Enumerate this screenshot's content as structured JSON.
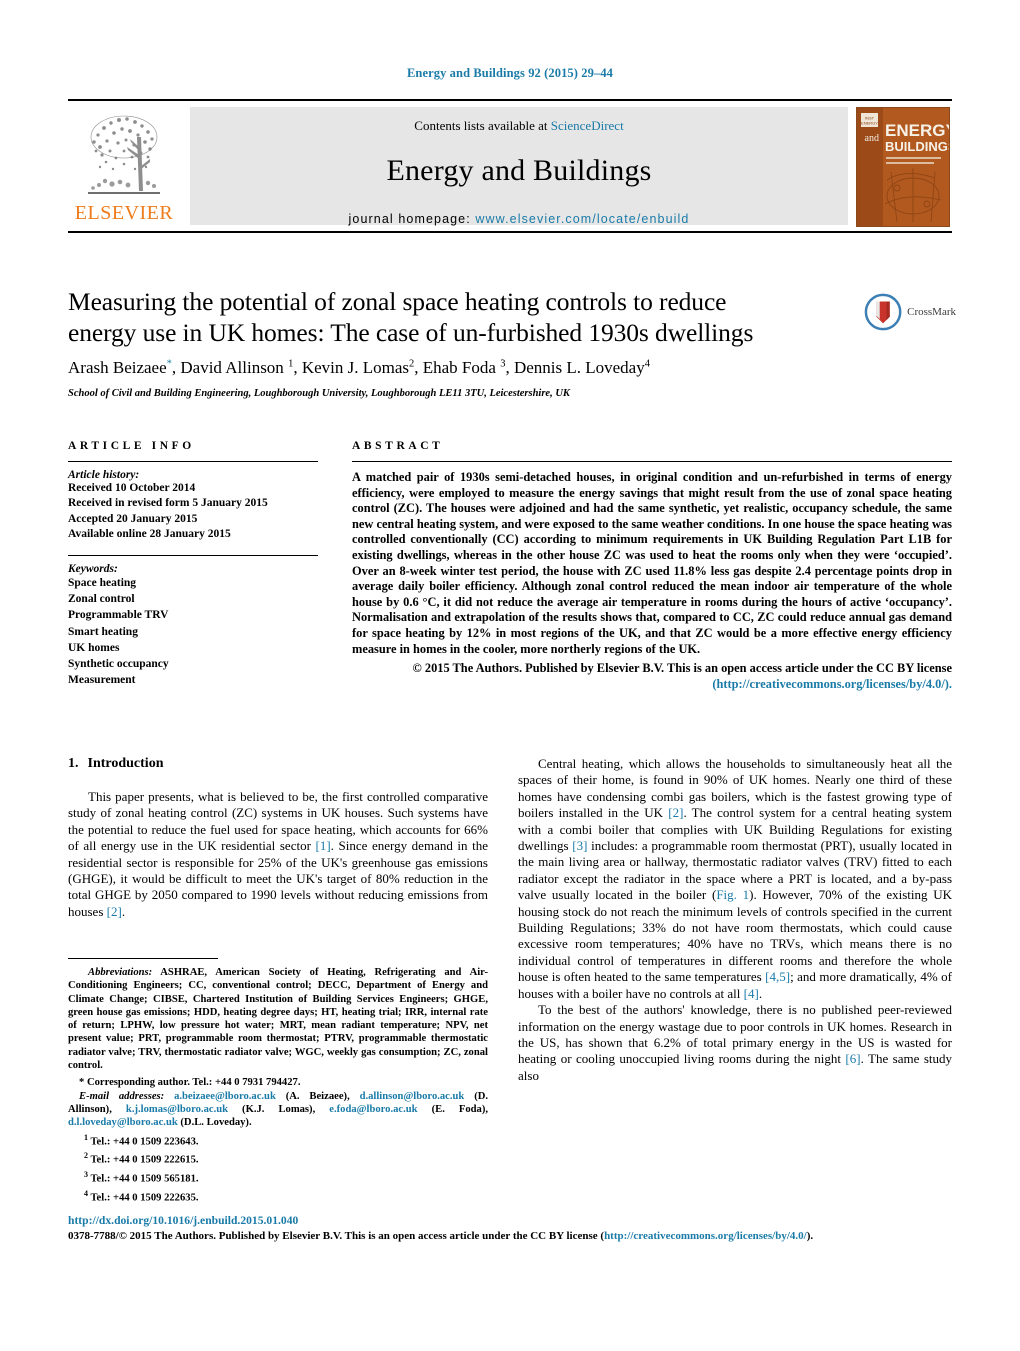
{
  "running_head": "Energy and Buildings 92 (2015) 29–44",
  "masthead": {
    "publisher_name": "ELSEVIER",
    "tree_logo_name": "elsevier-tree-logo",
    "contents_prefix": "Contents lists available at ",
    "sciencedirect_label": "ScienceDirect",
    "journal_title": "Energy and Buildings",
    "homepage_label": "journal homepage:",
    "homepage_url": "www.elsevier.com/locate/enbuild",
    "cover": {
      "and_word": "and",
      "line1": "ENERGY",
      "line2": "BUILDINGS"
    }
  },
  "article": {
    "title": "Measuring the potential of zonal space heating controls to reduce energy use in UK homes: The case of un-furbished 1930s dwellings",
    "crossmark_label": "CrossMark",
    "authors_html": "Arash Beizaee<sup class=\"star\">*</sup>, David Allinson <sup>1</sup>, Kevin J. Lomas<sup>2</sup>, Ehab Foda <sup>3</sup>, Dennis L. Loveday<sup>4</sup>",
    "affiliation": "School of Civil and Building Engineering, Loughborough University, Loughborough LE11 3TU, Leicestershire, UK"
  },
  "article_info": {
    "heading": "ARTICLE INFO",
    "history_label": "Article history:",
    "history": [
      "Received 10 October 2014",
      "Received in revised form 5 January 2015",
      "Accepted 20 January 2015",
      "Available online 28 January 2015"
    ],
    "keywords_label": "Keywords:",
    "keywords": [
      "Space heating",
      "Zonal control",
      "Programmable TRV",
      "Smart heating",
      "UK homes",
      "Synthetic occupancy",
      "Measurement"
    ]
  },
  "abstract": {
    "heading": "ABSTRACT",
    "text": "A matched pair of 1930s semi-detached houses, in original condition and un-refurbished in terms of energy efficiency, were employed to measure the energy savings that might result from the use of zonal space heating control (ZC). The houses were adjoined and had the same synthetic, yet realistic, occupancy schedule, the same new central heating system, and were exposed to the same weather conditions. In one house the space heating was controlled conventionally (CC) according to minimum requirements in UK Building Regulation Part L1B for existing dwellings, whereas in the other house ZC was used to heat the rooms only when they were ‘occupied’. Over an 8-week winter test period, the house with ZC used 11.8% less gas despite 2.4 percentage points drop in average daily boiler efficiency. Although zonal control reduced the mean indoor air temperature of the whole house by 0.6 °C, it did not reduce the average air temperature in rooms during the hours of active ‘occupancy’. Normalisation and extrapolation of the results shows that, compared to CC, ZC could reduce annual gas demand for space heating by 12% in most regions of the UK, and that ZC would be a more effective energy efficiency measure in homes in the cooler, more northerly regions of the UK.",
    "copyright_text": "© 2015 The Authors. Published by Elsevier B.V. This is an open access article under the CC BY license",
    "license_url": "(http://creativecommons.org/licenses/by/4.0/)."
  },
  "introduction": {
    "number": "1.",
    "heading": "Introduction",
    "para1_parts": {
      "a": "This paper presents, what is believed to be, the first controlled comparative study of zonal heating control (ZC) systems in UK houses. Such systems have the potential to reduce the fuel used for space heating, which accounts for 66% of all energy use in the UK residential sector ",
      "ref1": "[1]",
      "b": ". Since energy demand in the residential sector is responsible for 25% of the UK's greenhouse gas emissions (GHGE), it would be difficult to meet the UK's target of 80% reduction in the total GHGE by 2050 compared to 1990 levels without reducing emissions from houses ",
      "ref2": "[2]",
      "c": "."
    },
    "para2_parts": {
      "a": "Central heating, which allows the households to simultaneously heat all the spaces of their home, is found in 90% of UK homes. Nearly one third of these homes have condensing combi gas boilers, which is the fastest growing type of boilers installed in the UK ",
      "ref1": "[2]",
      "b": ". The control system for a central heating system with a combi boiler that complies with UK Building Regulations for existing dwellings ",
      "ref2": "[3]",
      "c": " includes: a programmable room thermostat (PRT), usually located in the main living area or hallway, thermostatic radiator valves (TRV) fitted to each radiator except the radiator in the space where a PRT is located, and a by-pass valve usually located in the boiler (",
      "ref3": "Fig. 1",
      "d": "). However, 70% of the existing UK housing stock do not reach the minimum levels of controls specified in the current Building Regulations; 33% do not have room thermostats, which could cause excessive room temperatures; 40% have no TRVs, which means there is no individual control of temperatures in different rooms and therefore the whole house is often heated to the same temperatures ",
      "ref4": "[4,5]",
      "e": "; and more dramatically, 4% of houses with a boiler have no controls at all ",
      "ref5": "[4]",
      "f": "."
    },
    "para3_parts": {
      "a": "To the best of the authors' knowledge, there is no published peer-reviewed information on the energy wastage due to poor controls in UK homes. Research in the US, has shown that 6.2% of total primary energy in the US is wasted for heating or cooling unoccupied living rooms during the night ",
      "ref1": "[6]",
      "b": ". The same study also"
    }
  },
  "footnotes": {
    "abbrev_label": "Abbreviations:",
    "abbrev_text": " ASHRAE, American Society of Heating, Refrigerating and Air-Conditioning Engineers; CC, conventional control; DECC, Department of Energy and Climate Change; CIBSE, Chartered Institution of Building Services Engineers; GHGE, green house gas emissions; HDD, heating degree days; HT, heating trial; IRR, internal rate of return; LPHW, low pressure hot water; MRT, mean radiant temperature; NPV, net present value; PRT, programmable room thermostat; PTRV, programmable thermostatic radiator valve; TRV, thermostatic radiator valve; WGC, weekly gas consumption; ZC, zonal control.",
    "corresponding": "* Corresponding author. Tel.: +44 0 7931 794427.",
    "email_label": "E-mail addresses:",
    "emails": [
      {
        "address": "a.beizaee@lboro.ac.uk",
        "person": "(A. Beizaee)"
      },
      {
        "address": "d.allinson@lboro.ac.uk",
        "person": "(D. Allinson)"
      },
      {
        "address": "k.j.lomas@lboro.ac.uk",
        "person": "(K.J. Lomas)"
      },
      {
        "address": "e.foda@lboro.ac.uk",
        "person": "(E. Foda)"
      },
      {
        "address": "d.l.loveday@lboro.ac.uk",
        "person": "(D.L. Loveday)"
      }
    ],
    "tels": [
      {
        "sup": "1",
        "text": "Tel.: +44 0 1509 223643."
      },
      {
        "sup": "2",
        "text": "Tel.: +44 0 1509 222615."
      },
      {
        "sup": "3",
        "text": "Tel.: +44 0 1509 565181."
      },
      {
        "sup": "4",
        "text": "Tel.: +44 0 1509 222635."
      }
    ]
  },
  "footer": {
    "doi": "http://dx.doi.org/10.1016/j.enbuild.2015.01.040",
    "issn_copyright": "0378-7788/© 2015 The Authors. Published by Elsevier B.V. This is an open access article under the CC BY license (",
    "license_url": "http://creativecommons.org/licenses/by/4.0/",
    "tail": ")."
  },
  "colors": {
    "link": "#1a7ba8",
    "elsevier_orange": "#ef7c1a",
    "band_gray": "#e6e6e6"
  }
}
